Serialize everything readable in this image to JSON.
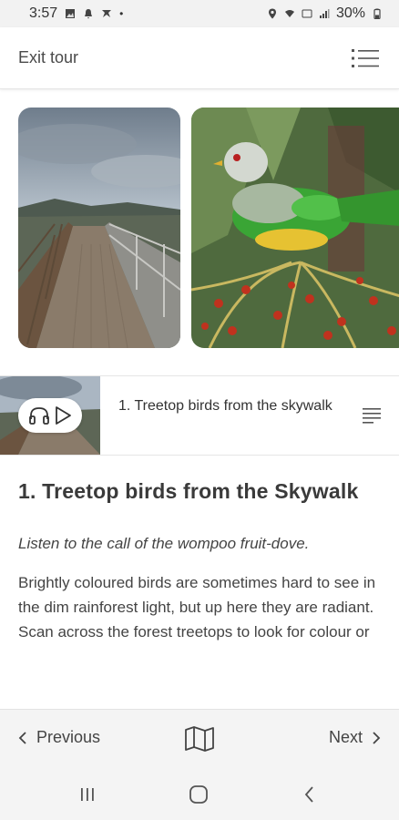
{
  "status_bar": {
    "time": "3:57",
    "battery": "30%"
  },
  "header": {
    "exit_label": "Exit tour"
  },
  "gallery": {
    "images": [
      {
        "name": "skywalk-photo"
      },
      {
        "name": "fruit-dove-photo"
      }
    ]
  },
  "player": {
    "track_title": "1. Treetop birds from the skywalk"
  },
  "stop": {
    "heading": "1. Treetop birds from the Skywalk",
    "subtitle": "Listen to the call of the wompoo fruit-dove.",
    "body": "Brightly coloured birds are sometimes hard to see in the dim rainforest light, but up here they are radiant. Scan across the forest treetops to look for colour or"
  },
  "bottom_nav": {
    "previous_label": "Previous",
    "next_label": "Next"
  },
  "colors": {
    "text": "#444444",
    "nav_bg": "#f4f4f4",
    "dove_green": "#3aa535"
  }
}
